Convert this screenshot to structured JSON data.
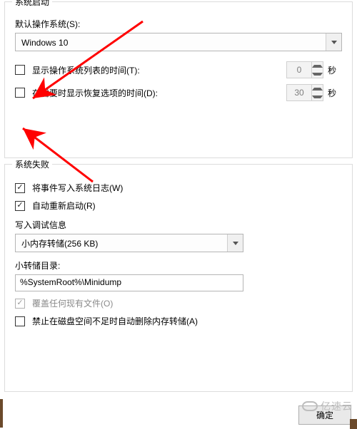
{
  "startup": {
    "title": "系统启动",
    "default_os_label": "默认操作系统(S):",
    "default_os_value": "Windows 10",
    "show_os_list_label": "显示操作系统列表的时间(T):",
    "show_os_list_seconds": "0",
    "show_recovery_label": "在需要时显示恢复选项的时间(D):",
    "show_recovery_seconds": "30",
    "seconds_unit": "秒"
  },
  "failure": {
    "title": "系统失败",
    "write_event_label": "将事件写入系统日志(W)",
    "auto_restart_label": "自动重新启动(R)",
    "debug_info_label": "写入调试信息",
    "dump_type_value": "小内存转储(256 KB)",
    "dump_dir_label": "小转储目录:",
    "dump_dir_value": "%SystemRoot%\\Minidump",
    "overwrite_label": "覆盖任何现有文件(O)",
    "no_delete_low_space_label": "禁止在磁盘空间不足时自动删除内存转储(A)"
  },
  "buttons": {
    "ok": "确定"
  },
  "watermark": "亿速云",
  "annotation_color": "#ff0000"
}
